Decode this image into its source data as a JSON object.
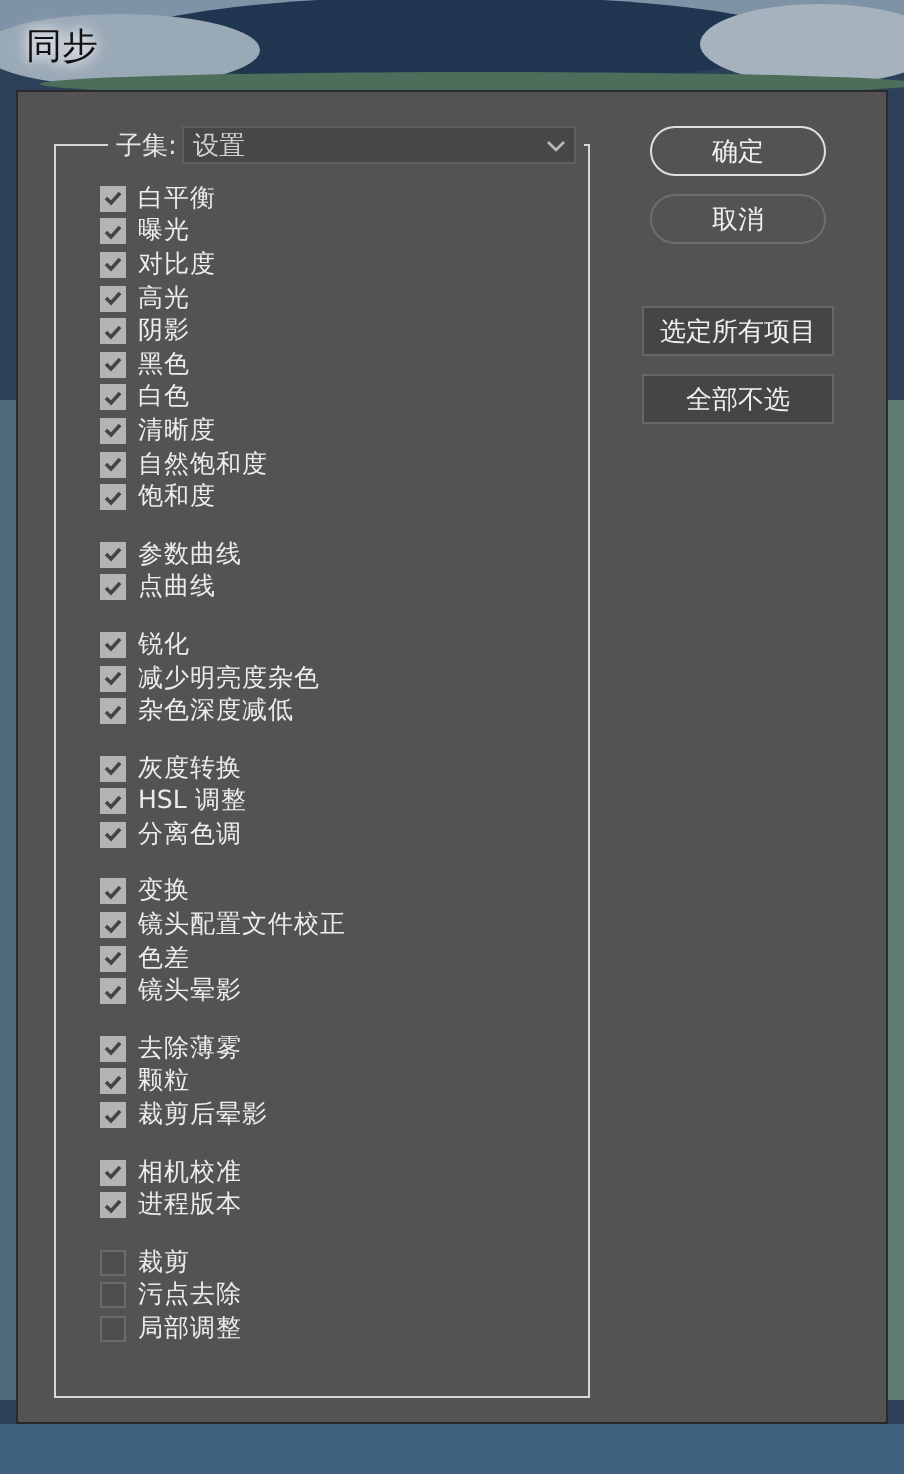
{
  "window": {
    "title": "同步"
  },
  "subset": {
    "label": "子集:",
    "value": "设置"
  },
  "groups": [
    {
      "items": [
        {
          "label": "白平衡",
          "checked": true
        },
        {
          "label": "曝光",
          "checked": true
        },
        {
          "label": "对比度",
          "checked": true
        },
        {
          "label": "高光",
          "checked": true
        },
        {
          "label": "阴影",
          "checked": true
        },
        {
          "label": "黑色",
          "checked": true
        },
        {
          "label": "白色",
          "checked": true
        },
        {
          "label": "清晰度",
          "checked": true
        },
        {
          "label": "自然饱和度",
          "checked": true
        },
        {
          "label": "饱和度",
          "checked": true
        }
      ]
    },
    {
      "items": [
        {
          "label": "参数曲线",
          "checked": true
        },
        {
          "label": "点曲线",
          "checked": true
        }
      ]
    },
    {
      "items": [
        {
          "label": "锐化",
          "checked": true
        },
        {
          "label": "减少明亮度杂色",
          "checked": true
        },
        {
          "label": "杂色深度减低",
          "checked": true
        }
      ]
    },
    {
      "items": [
        {
          "label": "灰度转换",
          "checked": true
        },
        {
          "label": "HSL 调整",
          "checked": true
        },
        {
          "label": "分离色调",
          "checked": true
        }
      ]
    },
    {
      "items": [
        {
          "label": "变换",
          "checked": true
        },
        {
          "label": "镜头配置文件校正",
          "checked": true
        },
        {
          "label": "色差",
          "checked": true
        },
        {
          "label": "镜头晕影",
          "checked": true
        }
      ]
    },
    {
      "items": [
        {
          "label": "去除薄雾",
          "checked": true
        },
        {
          "label": "颗粒",
          "checked": true
        },
        {
          "label": "裁剪后晕影",
          "checked": true
        }
      ]
    },
    {
      "items": [
        {
          "label": "相机校准",
          "checked": true
        },
        {
          "label": "进程版本",
          "checked": true
        }
      ]
    },
    {
      "items": [
        {
          "label": "裁剪",
          "checked": false
        },
        {
          "label": "污点去除",
          "checked": false
        },
        {
          "label": "局部调整",
          "checked": false
        }
      ]
    }
  ],
  "dialog_buttons": [
    {
      "label": "确定",
      "default": true
    },
    {
      "label": "取消",
      "default": false
    }
  ],
  "selection_buttons": [
    {
      "label": "选定所有项目"
    },
    {
      "label": "全部不选"
    }
  ]
}
